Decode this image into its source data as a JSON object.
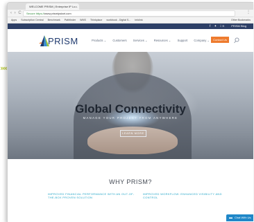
{
  "browser": {
    "tab_title": "WELCOME PRISM | Enterprise IP Lo...",
    "tab_close": "×",
    "nav_buttons": "‹ › C",
    "url_prefix": "Secure https://",
    "url_host": "www.prismipstart.com",
    "menu": "⋮",
    "bookmarks": [
      "Apps",
      "Subscription Central",
      "Benchmark",
      "Pathfinder",
      "WMS",
      "Thinkplace",
      "workbook - Digital S...",
      "Infolink"
    ],
    "bookmark_other": "Other Bookmarks"
  },
  "utility_bar": {
    "social_icons": "f ✦ in",
    "phone": "PRISM Blog"
  },
  "site": {
    "logo_text": "PRISM",
    "nav": [
      "Products ⌄",
      "Customers",
      "Services ⌄",
      "Resources ⌄",
      "Support",
      "Company ⌄"
    ],
    "contact_label": "Contact Us"
  },
  "hero": {
    "title": "Global Connectivity",
    "subtitle": "MANAGE YOUR PROJECT FROM ANYWHERE",
    "cta_label": "LEARN MORE"
  },
  "why": {
    "heading": "WHY PRISM?",
    "features": [
      "IMPROVED FINANCIAL PERFORMANCE WITH AN OUT-OF-THE-BOX PROVEN SOLUTION",
      "IMPROVED WORKFLOW: ENHANCED VISIBILITY AND CONTROL"
    ]
  },
  "chat": {
    "label": "Chat With Us"
  },
  "decor": {
    "arrows": "»»"
  },
  "colors": {
    "brand_navy": "#1f3a6e",
    "cta_orange": "#ee7b2e",
    "feature_blue": "#27a7c9",
    "chat_blue": "#1f87c8",
    "utility_bar": "#2d3f66",
    "arrow_green": "#b9c93a"
  }
}
